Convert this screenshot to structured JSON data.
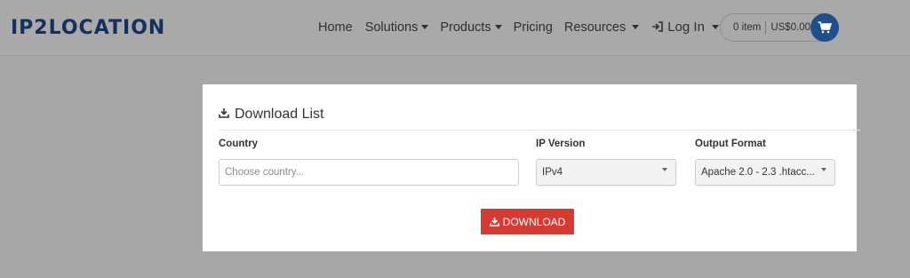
{
  "header": {
    "logo_text": "IP2LOCATION",
    "nav": [
      {
        "label": "Home"
      },
      {
        "label": "Solutions"
      },
      {
        "label": "Products"
      },
      {
        "label": "Pricing"
      },
      {
        "label": "Resources"
      },
      {
        "label": "Log In"
      }
    ],
    "cart": {
      "items": "0 item",
      "total": "US$0.00"
    }
  },
  "card": {
    "title": "Download List",
    "country": {
      "label": "Country",
      "placeholder": "Choose country..."
    },
    "ip_version": {
      "label": "IP Version",
      "value": "IPv4"
    },
    "output_format": {
      "label": "Output Format",
      "value": "Apache 2.0 - 2.3 .htacc..."
    },
    "download_button": "DOWNLOAD"
  },
  "colors": {
    "brand": "#14305b",
    "cart_button": "#1f4f8d",
    "download_button": "#d53b33",
    "overlay": "#a7a7a7"
  }
}
